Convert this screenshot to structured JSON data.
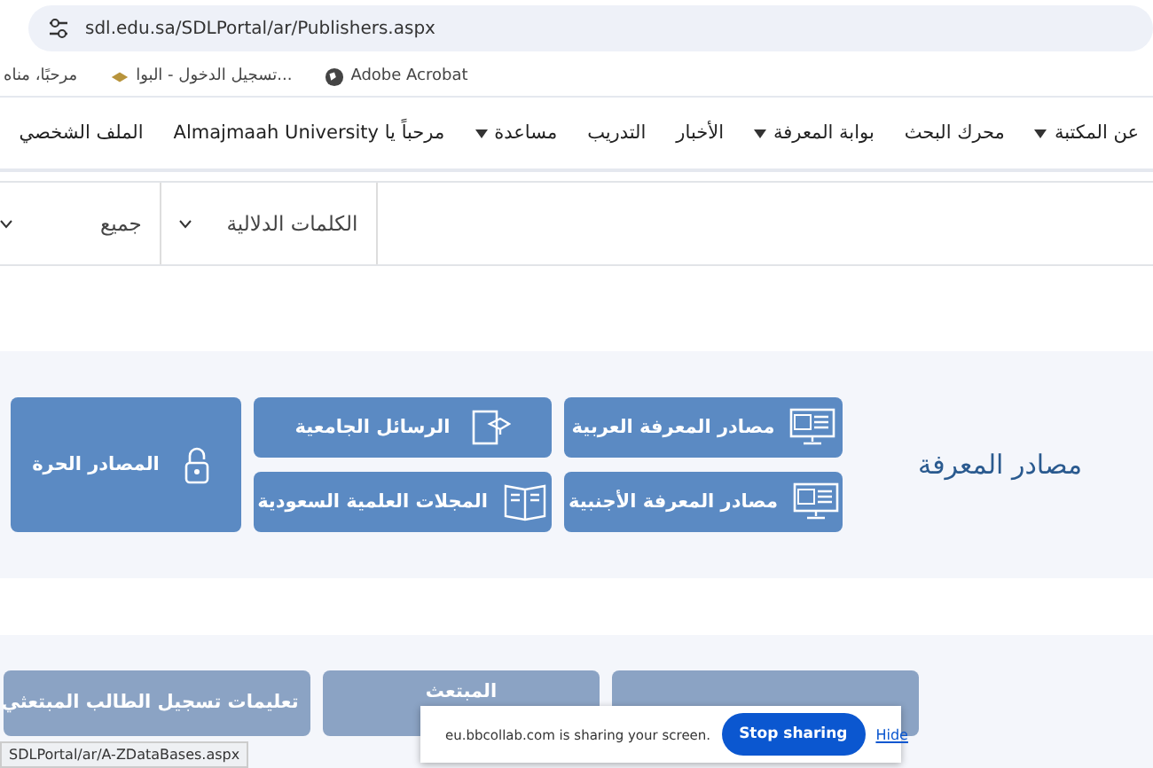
{
  "browser": {
    "url": "sdl.edu.sa/SDLPortal/ar/Publishers.aspx",
    "bookmarks": [
      {
        "label": "Adobe Acrobat",
        "kind": "globe"
      },
      {
        "label": "تسجيل الدخول - البوا...",
        "kind": "logo"
      },
      {
        "label": "مرحبًا، مناه",
        "kind": "none"
      }
    ]
  },
  "nav": [
    {
      "label": "عن المكتبة",
      "dropdown": true
    },
    {
      "label": "محرك البحث",
      "dropdown": false
    },
    {
      "label": "بوابة المعرفة",
      "dropdown": true
    },
    {
      "label": "الأخبار",
      "dropdown": false
    },
    {
      "label": "التدريب",
      "dropdown": false
    },
    {
      "label": "مساعدة",
      "dropdown": true
    },
    {
      "label": "مرحباً يا Almajmaah University",
      "dropdown": false
    },
    {
      "label": "الملف الشخصي",
      "dropdown": false
    }
  ],
  "search": {
    "filters": [
      "الكلمات الدلالية",
      "جميع"
    ]
  },
  "knowledge": {
    "title": "مصادر المعرفة",
    "buttons": [
      {
        "label": "مصادر المعرفة العربية",
        "kind": "monitor"
      },
      {
        "label": "مصادر المعرفة الأجنبية",
        "kind": "monitor"
      },
      {
        "label": "الرسائل الجامعية",
        "kind": "thesis"
      },
      {
        "label": "المجلات العلمية السعودية",
        "kind": "book"
      },
      {
        "label": "المصادر الحرة",
        "kind": "lock"
      }
    ]
  },
  "lower": {
    "buttons": [
      {
        "kind": "plain"
      },
      {
        "label": "المبتعث",
        "kind": "plain"
      },
      {
        "label": "تعليمات تسجيل الطالب المبتعثي",
        "kind": "page"
      }
    ]
  },
  "share_bar": {
    "message": "eu.bbcollab.com is sharing your screen.",
    "stop": "Stop sharing",
    "hide": "Hide"
  },
  "status_url": "SDLPortal/ar/A-ZDataBases.aspx"
}
